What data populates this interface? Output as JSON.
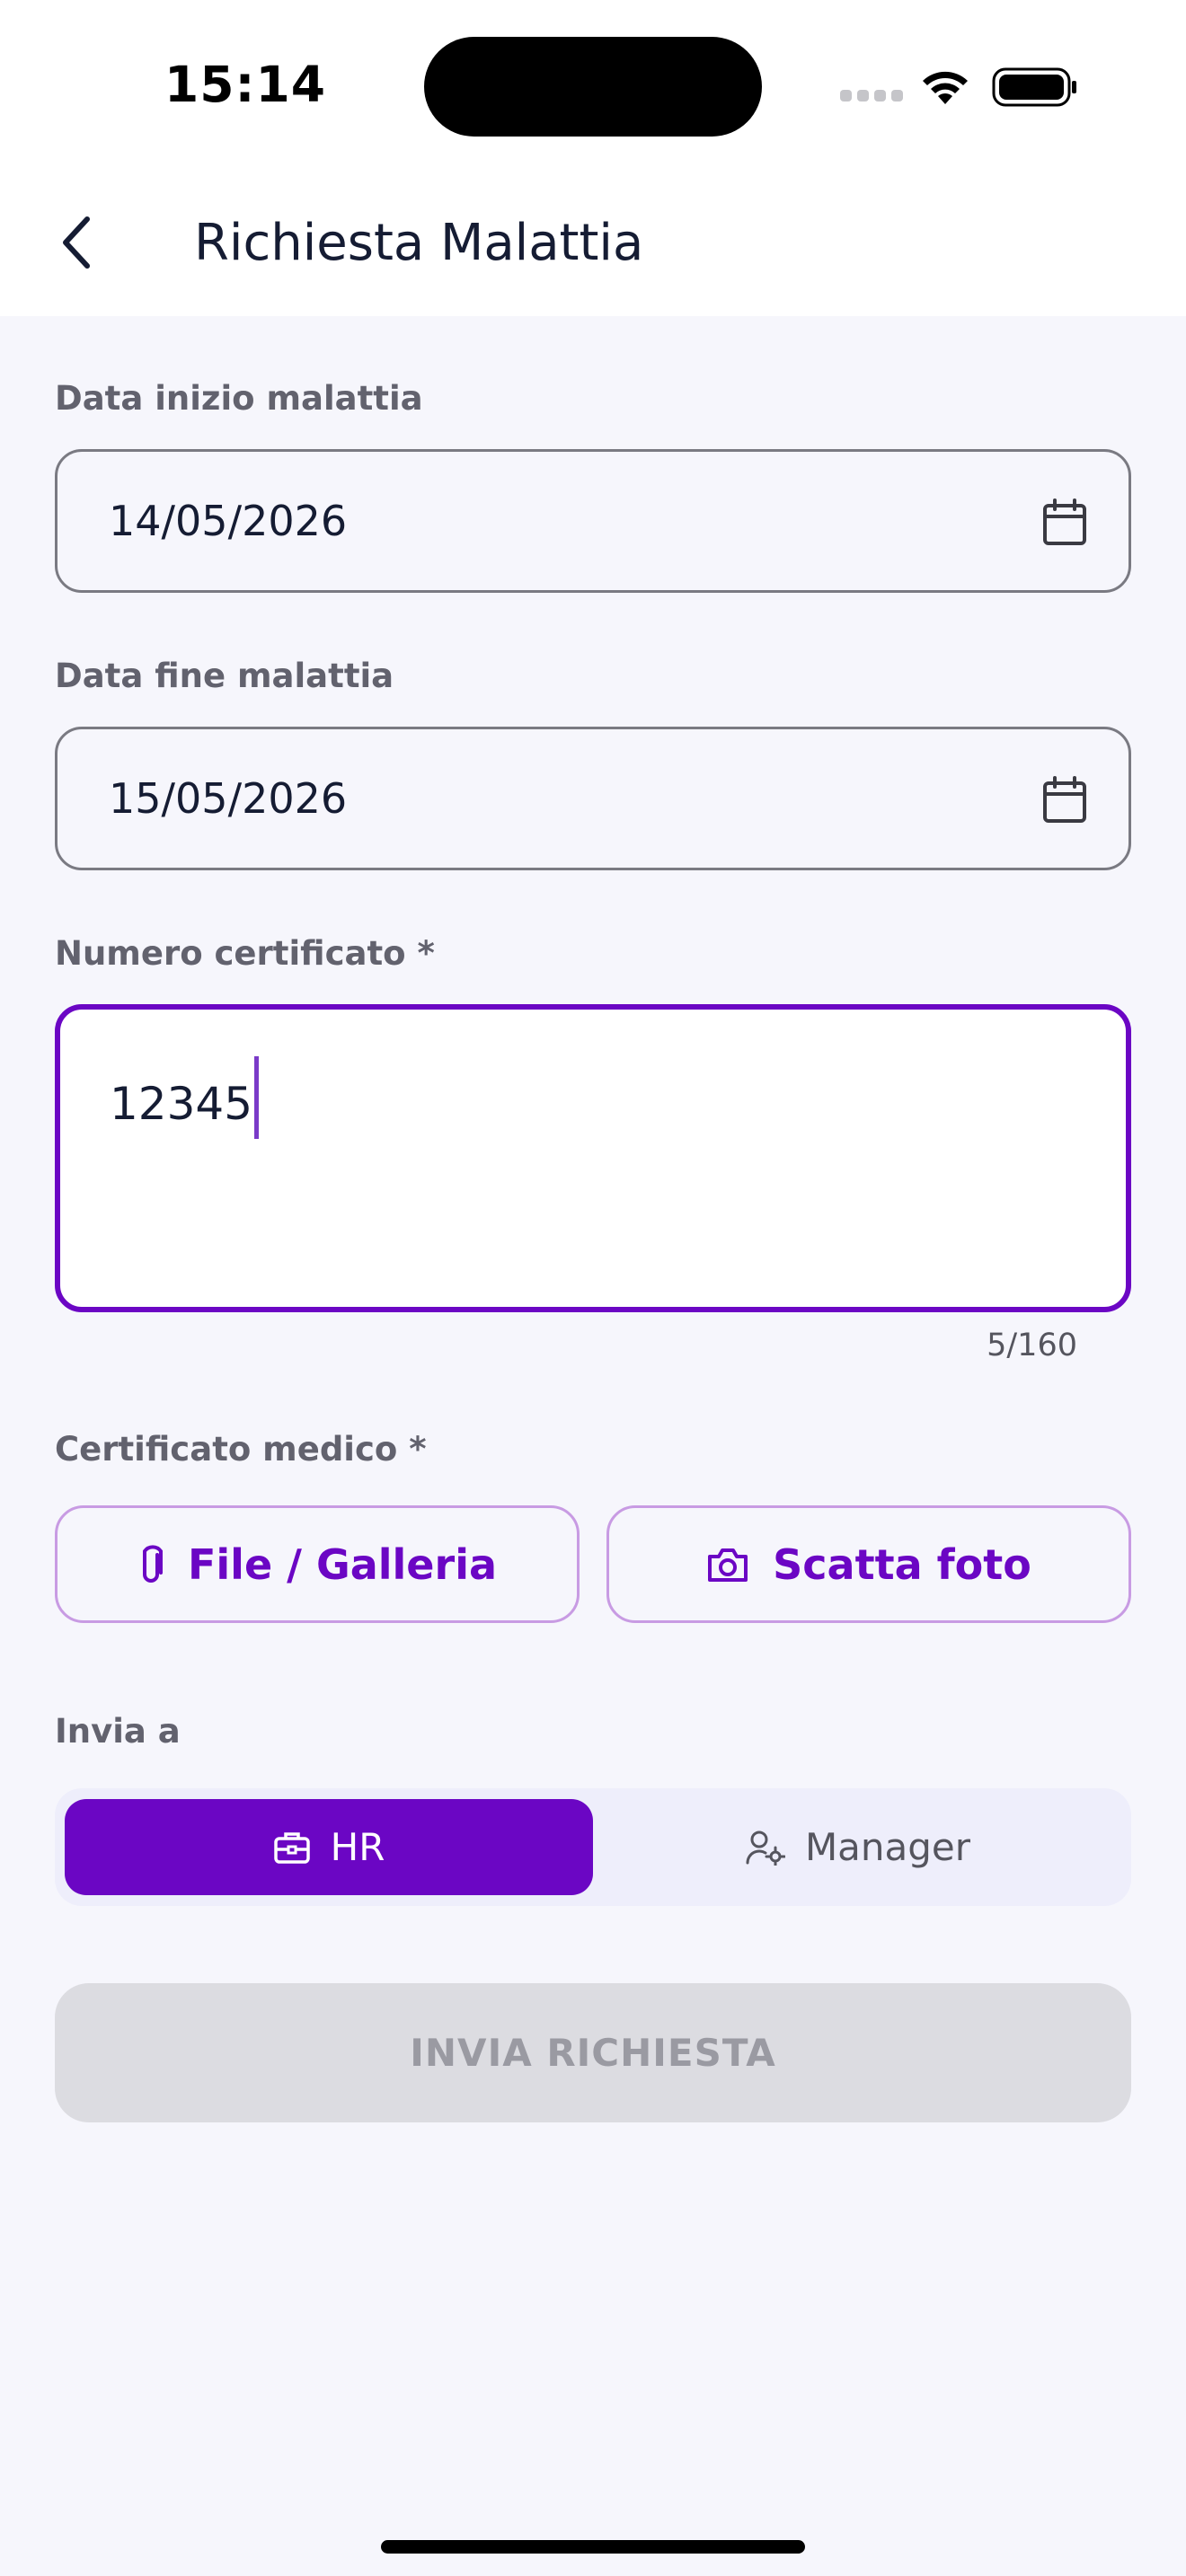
{
  "status_bar": {
    "time": "15:14",
    "signal_icon": "signal-dots-icon",
    "wifi_icon": "wifi-icon",
    "battery_icon": "battery-full-icon"
  },
  "header": {
    "back_icon": "chevron-left-icon",
    "title": "Richiesta Malattia"
  },
  "form": {
    "start_date": {
      "label": "Data inizio malattia",
      "value": "14/05/2026",
      "icon": "calendar-icon"
    },
    "end_date": {
      "label": "Data fine malattia",
      "value": "15/05/2026",
      "icon": "calendar-icon"
    },
    "certificate_number": {
      "label": "Numero certificato *",
      "value": "12345",
      "counter": "5/160"
    },
    "medical_certificate": {
      "label": "Certificato medico *",
      "file_button": {
        "label": "File / Galleria",
        "icon": "paperclip-icon"
      },
      "photo_button": {
        "label": "Scatta foto",
        "icon": "camera-icon"
      }
    },
    "send_to": {
      "label": "Invia a",
      "options": [
        {
          "label": "HR",
          "icon": "briefcase-icon",
          "selected": true
        },
        {
          "label": "Manager",
          "icon": "user-gear-icon",
          "selected": false
        }
      ]
    },
    "submit": {
      "label": "INVIA RICHIESTA",
      "enabled": false
    }
  },
  "colors": {
    "accent": "#6B06C4",
    "accent_border_light": "#C89BE3",
    "background": "#F6F6FC",
    "disabled_button": "#DCDCE1"
  }
}
